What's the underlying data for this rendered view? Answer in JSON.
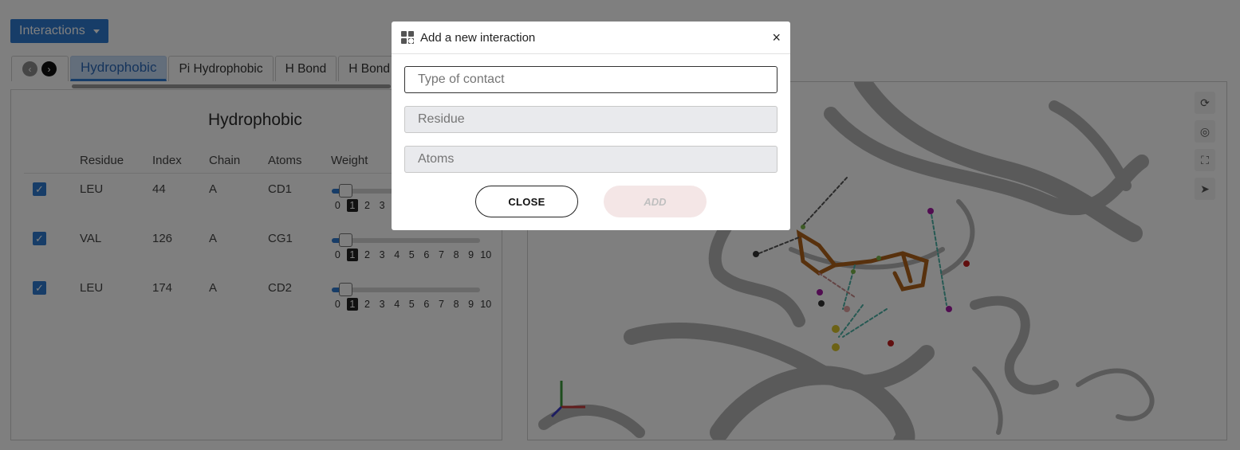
{
  "toolbar": {
    "interactions_label": "Interactions"
  },
  "tabs": [
    {
      "label": "Hydrophobic",
      "active": true
    },
    {
      "label": "Pi Hydrophobic",
      "active": false
    },
    {
      "label": "H Bond",
      "active": false
    },
    {
      "label": "H Bond",
      "active": false
    }
  ],
  "panel": {
    "title": "Hydrophobic",
    "columns": [
      "Residue",
      "Index",
      "Chain",
      "Atoms",
      "Weight"
    ],
    "rows": [
      {
        "checked": true,
        "residue": "LEU",
        "index": "44",
        "chain": "A",
        "atoms": "CD1",
        "weight": 1
      },
      {
        "checked": true,
        "residue": "VAL",
        "index": "126",
        "chain": "A",
        "atoms": "CG1",
        "weight": 1
      },
      {
        "checked": true,
        "residue": "LEU",
        "index": "174",
        "chain": "A",
        "atoms": "CD2",
        "weight": 1
      }
    ],
    "weight_ticks": [
      "0",
      "1",
      "2",
      "3",
      "4",
      "5",
      "6",
      "7",
      "8",
      "9",
      "10"
    ]
  },
  "viewer": {
    "tools": [
      "refresh-icon",
      "target-icon",
      "fullscreen-icon",
      "pointer-icon"
    ]
  },
  "modal": {
    "title": "Add a new interaction",
    "close_symbol": "×",
    "fields": {
      "type_placeholder": "Type of contact",
      "residue_placeholder": "Residue",
      "atoms_placeholder": "Atoms"
    },
    "close_label": "CLOSE",
    "add_label": "ADD"
  }
}
